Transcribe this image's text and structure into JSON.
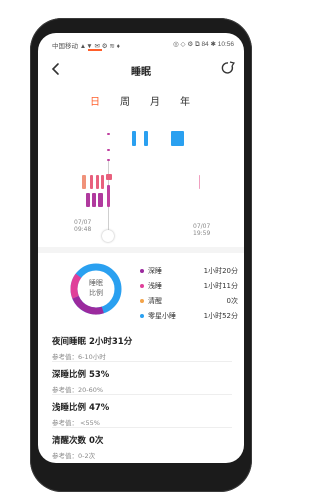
{
  "status": {
    "left": "中国移动 ▲▼ ✉ ⚙ ≋ ♦",
    "right": "◎ ◇ ⚙ ⧉ 84 ✱ 10:56"
  },
  "header": {
    "title": "睡眠"
  },
  "tabs": [
    {
      "label": "日",
      "active": true
    },
    {
      "label": "周",
      "active": false
    },
    {
      "label": "月",
      "active": false
    },
    {
      "label": "年",
      "active": false
    }
  ],
  "timeline": {
    "start": {
      "date": "07/07",
      "time": "09:48"
    },
    "end": {
      "date": "07/07",
      "time": "19:59"
    }
  },
  "donut": {
    "label_line1": "睡眠",
    "label_line2": "比例",
    "segments": [
      {
        "name": "深睡",
        "percent": 53,
        "color": "#9b2a9e"
      },
      {
        "name": "浅睡",
        "percent": 47,
        "color": "#e0409a"
      },
      {
        "name": "清醒",
        "percent": 0,
        "color": "#f3a44a"
      },
      {
        "name": "零星小睡",
        "percent": 0,
        "color": "#2aa0f0"
      }
    ]
  },
  "legend": [
    {
      "name": "深睡",
      "value": "1小时20分",
      "color": "#9b2a9e"
    },
    {
      "name": "浅睡",
      "value": "1小时11分",
      "color": "#e0409a"
    },
    {
      "name": "清醒",
      "value": "0次",
      "color": "#f3a44a"
    },
    {
      "name": "零星小睡",
      "value": "1小时52分",
      "color": "#2aa0f0"
    }
  ],
  "stats": [
    {
      "title": "夜间睡眠 2小时31分",
      "ref": "参考值：6-10小时"
    },
    {
      "title": "深睡比例 53%",
      "ref": "参考值：20-60%"
    },
    {
      "title": "浅睡比例 47%",
      "ref": "参考值：  <55%"
    },
    {
      "title": "清醒次数 0次",
      "ref": "参考值：0-2次"
    }
  ]
}
